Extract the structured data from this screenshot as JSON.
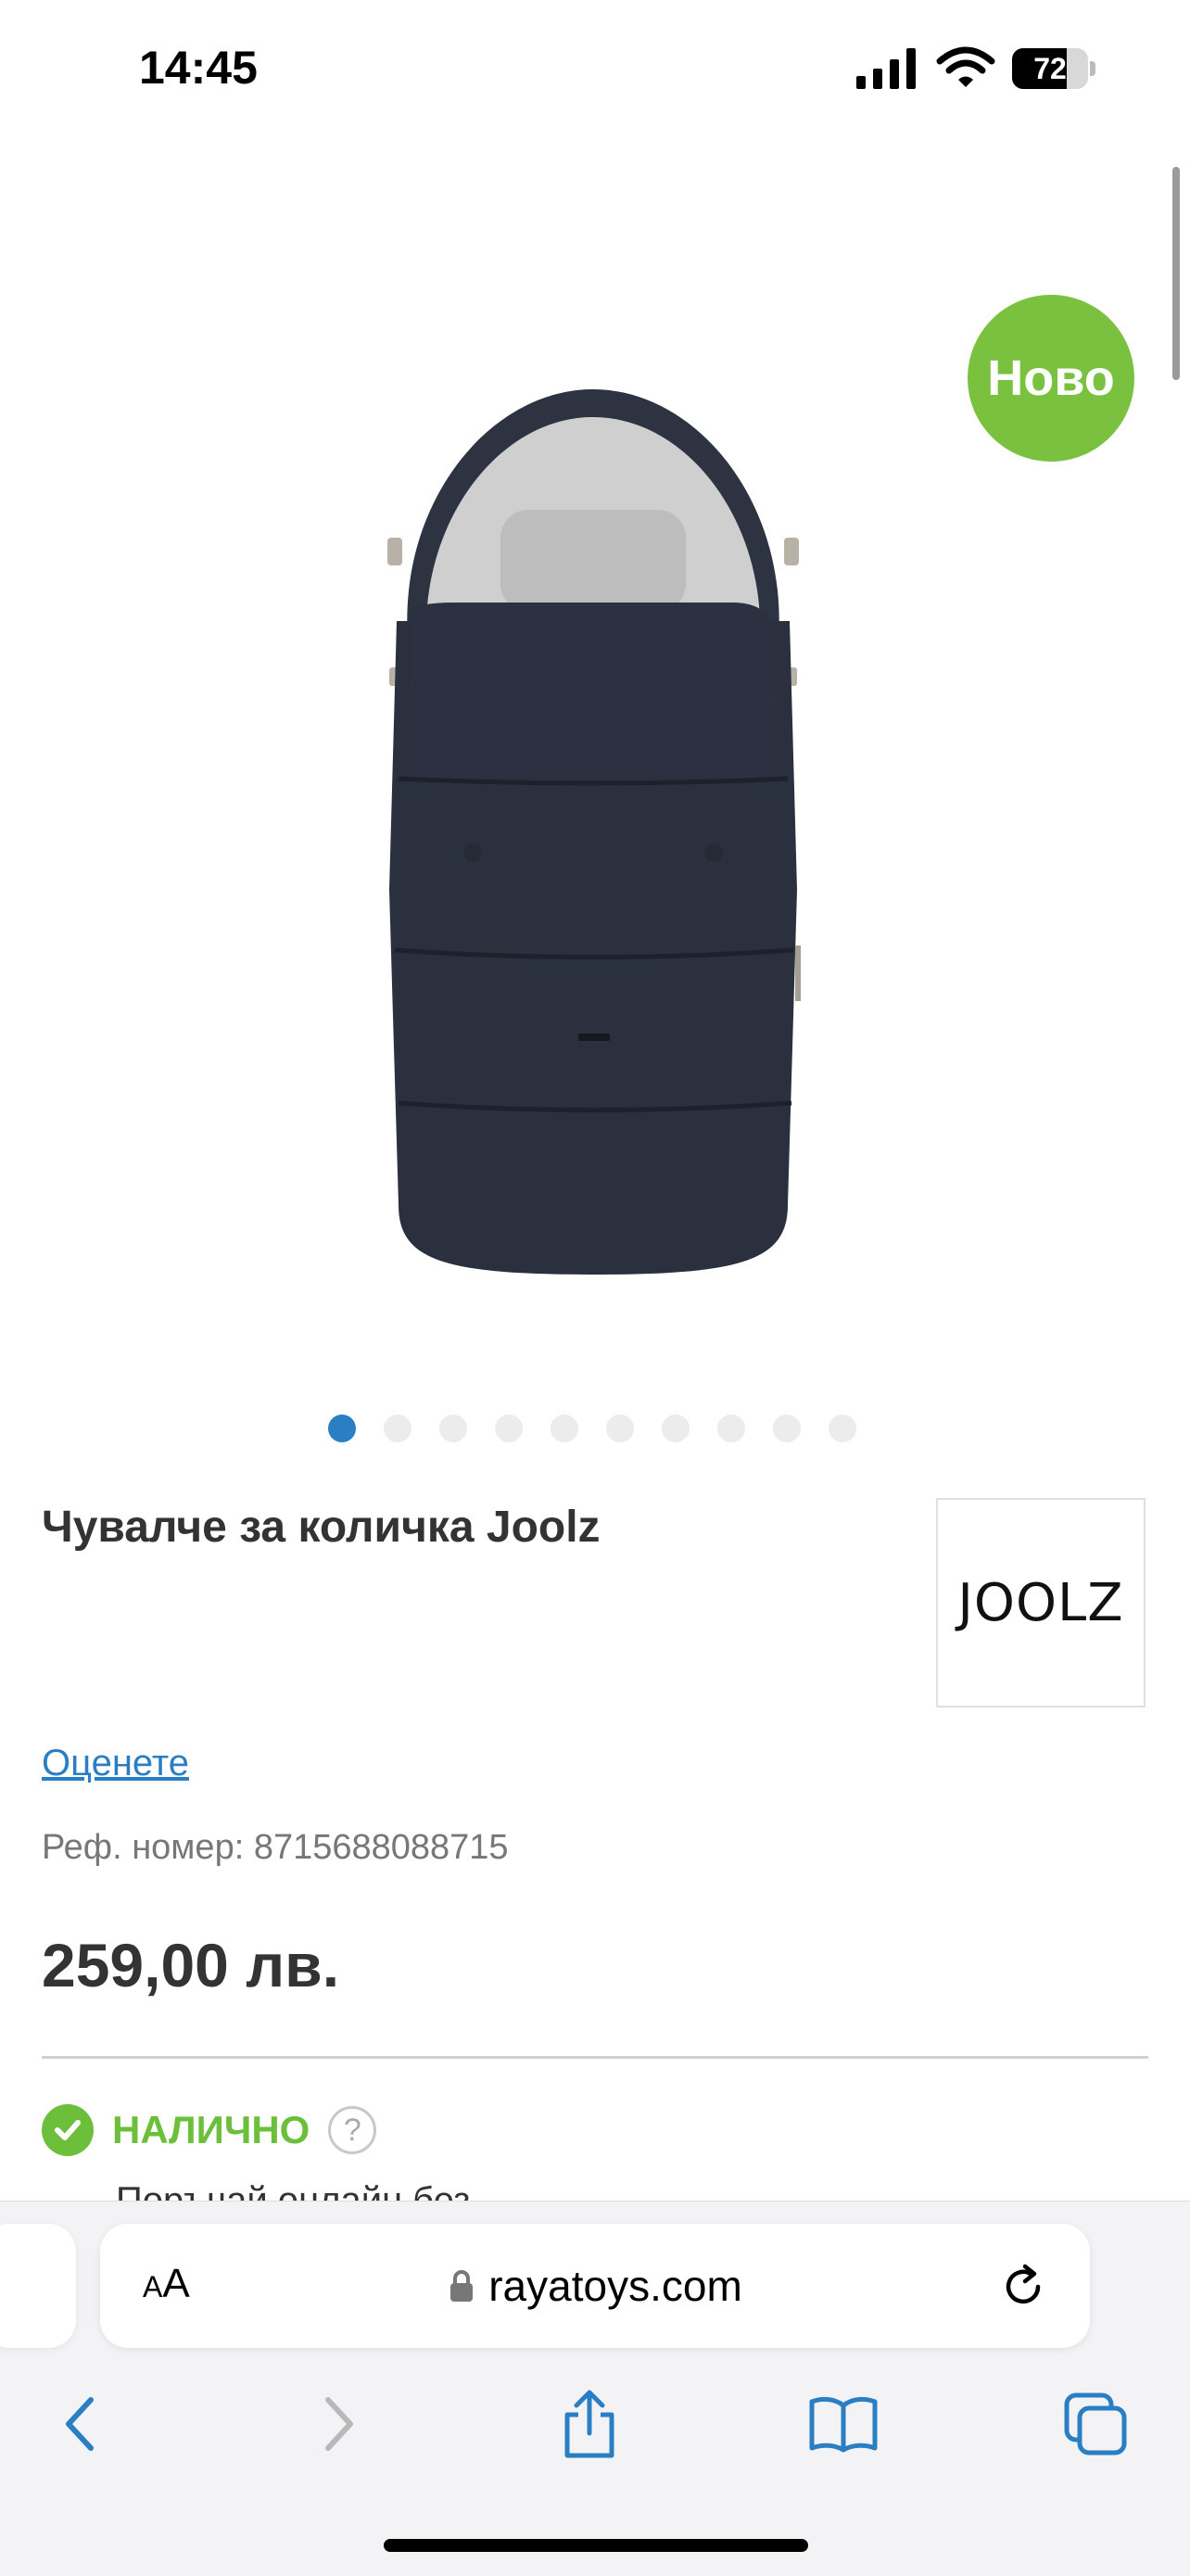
{
  "status_bar": {
    "time": "14:45",
    "battery": "72",
    "battery_level": 0.72
  },
  "product": {
    "badge": "Ново",
    "gallery_total": 10,
    "gallery_active_index": 0,
    "title": "Чувалче за количка Joolz",
    "brand_logo_text": "JOOLZ",
    "rate_link": "Оценете",
    "ref_label": "Реф. номер: 8715688088715",
    "price": "259,00 лв.",
    "availability": "НАЛИЧНО",
    "help_symbol": "?",
    "next_line_partial": "Поръчай онлайн без..."
  },
  "browser": {
    "aa_label": "AA",
    "url": "rayatoys.com"
  },
  "icons": {
    "signal": "signal-icon",
    "wifi": "wifi-icon",
    "lock": "lock-icon",
    "reload": "reload-icon",
    "back": "chevron-left-icon",
    "forward": "chevron-right-icon",
    "share": "share-icon",
    "bookmarks": "book-icon",
    "tabs": "tabs-icon"
  },
  "colors": {
    "accent": "#2a7fc4",
    "badge_green": "#79c13f",
    "stock_green": "#6cbf3a"
  }
}
